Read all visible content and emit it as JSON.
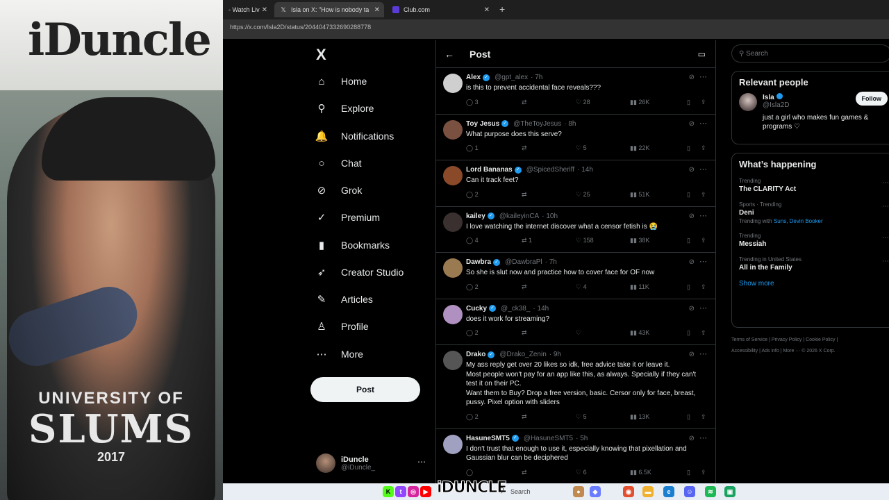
{
  "webcam": {
    "logo": "iDuncle",
    "shirt_line1": "UNIVERSITY OF",
    "shirt_line2": "SLUMS",
    "shirt_line3": "2017"
  },
  "browser": {
    "tabs": [
      {
        "label": "- Watch Liv"
      },
      {
        "label": "Isla on X: \"How is nobody talkin"
      },
      {
        "label": "Club.com"
      }
    ],
    "url": "https://x.com/Isla2D/status/2044047332690288778"
  },
  "sidebar": {
    "logo": "X",
    "items": [
      {
        "label": "Home",
        "icon": "⌂"
      },
      {
        "label": "Explore",
        "icon": "⚲"
      },
      {
        "label": "Notifications",
        "icon": "🔔"
      },
      {
        "label": "Chat",
        "icon": "○"
      },
      {
        "label": "Grok",
        "icon": "⊘"
      },
      {
        "label": "Premium",
        "icon": "✓"
      },
      {
        "label": "Bookmarks",
        "icon": "▮"
      },
      {
        "label": "Creator Studio",
        "icon": "➶"
      },
      {
        "label": "Articles",
        "icon": "✎"
      },
      {
        "label": "Profile",
        "icon": "♙"
      },
      {
        "label": "More",
        "icon": "⋯"
      }
    ],
    "post_button": "Post",
    "account": {
      "name": "iDuncle",
      "handle": "@iDuncle_"
    }
  },
  "main": {
    "title": "Post",
    "replies": [
      {
        "name": "Alex",
        "handle": "@gpt_alex",
        "time": "· 7h",
        "text": "is this to prevent accidental face reveals???",
        "replies": "3",
        "reposts": "",
        "likes": "28",
        "views": "26K",
        "avatar_color": "#cfcfcf"
      },
      {
        "name": "Toy Jesus",
        "handle": "@TheToyJesus",
        "time": "· 8h",
        "text": "What purpose does this serve?",
        "replies": "1",
        "reposts": "",
        "likes": "5",
        "views": "22K",
        "avatar_color": "#7a5040"
      },
      {
        "name": "Lord Bananas",
        "handle": "@SpicedSheriff",
        "time": "· 14h",
        "text": "Can it track feet?",
        "replies": "2",
        "reposts": "",
        "likes": "25",
        "views": "51K",
        "avatar_color": "#8a4a2a"
      },
      {
        "name": "kailey",
        "handle": "@kaileyinCA",
        "time": "· 10h",
        "text": "I love watching the internet discover what a censor fetish is 😭",
        "replies": "4",
        "reposts": "1",
        "likes": "158",
        "views": "38K",
        "avatar_color": "#3a3030"
      },
      {
        "name": "Dawbra",
        "handle": "@DawbraPl",
        "time": "· 7h",
        "text": "So she is slut now and practice how to cover face for OF now",
        "replies": "2",
        "reposts": "",
        "likes": "4",
        "views": "11K",
        "avatar_color": "#9a7a50"
      },
      {
        "name": "Cucky",
        "handle": "@_ck38_",
        "time": "· 14h",
        "text": "does it work for streaming?",
        "replies": "2",
        "reposts": "",
        "likes": "",
        "views": "43K",
        "avatar_color": "#b090c0"
      },
      {
        "name": "Drako",
        "handle": "@Drako_Zenin",
        "time": "· 9h",
        "text": "My ass reply get over 20 likes so idk, free advice take it or leave it.\nMost people won't pay for an app like this, as always. Specially if they can't test it on their PC.\nWant them to Buy? Drop a free version, basic. Cersor only for face, breast, pussy. Pixel option with sliders",
        "replies": "2",
        "reposts": "",
        "likes": "5",
        "views": "13K",
        "avatar_color": "#555555"
      },
      {
        "name": "HasuneSMT5",
        "handle": "@HasuneSMT5",
        "time": "· 5h",
        "text": "I don't trust that enough to use it, especially knowing that pixellation and Gaussian blur can be deciphered",
        "replies": "",
        "reposts": "",
        "likes": "6",
        "views": "6.5K",
        "avatar_color": "#a0a0c0"
      }
    ]
  },
  "right": {
    "search_placeholder": "Search",
    "relevant_title": "Relevant people",
    "person": {
      "name": "Isla",
      "handle": "@Isla2D",
      "bio": "just a girl who makes fun games & programs ♡",
      "follow": "Follow"
    },
    "happening_title": "What’s happening",
    "trends": [
      {
        "meta": "Trending",
        "title": "The CLARITY Act",
        "sub": "",
        "sub_link": ""
      },
      {
        "meta": "Sports · Trending",
        "title": "Deni",
        "sub": "Trending with",
        "sub_link": "Suns, Devin Booker"
      },
      {
        "meta": "Trending",
        "title": "Messiah",
        "sub": "",
        "sub_link": ""
      },
      {
        "meta": "Trending in United States",
        "title": "All in the Family",
        "sub": "",
        "sub_link": ""
      }
    ],
    "show_more": "Show more",
    "footer_line1": "Terms of Service  |  Privacy Policy  |  Cookie Policy  |",
    "footer_line2": "Accessibility  |  Ads info  |  More ···  © 2026 X Corp."
  },
  "taskbar": {
    "brand": "iDUNCLE",
    "search": "Search"
  }
}
